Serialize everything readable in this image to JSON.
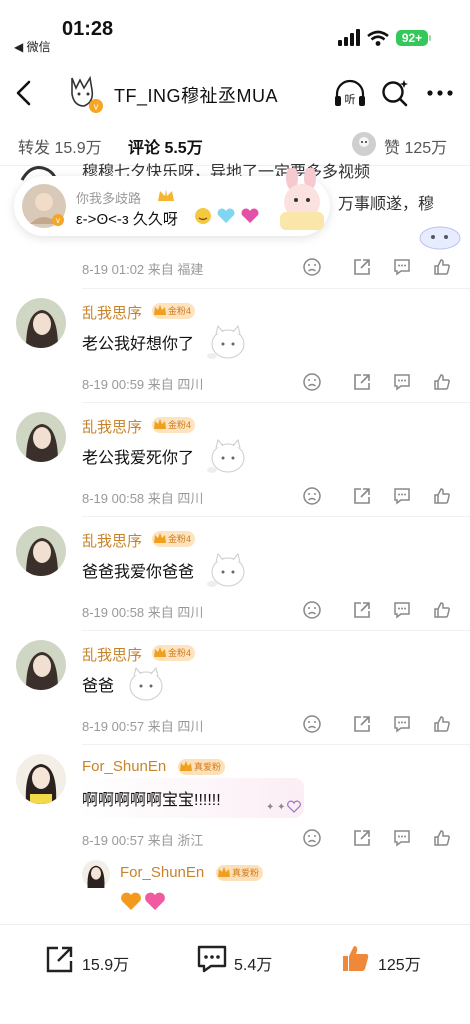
{
  "status": {
    "time": "01:28",
    "back_app": "◀ 微信",
    "battery": "92+"
  },
  "nav": {
    "title": "TF_ING穆祉丞MUA",
    "listen_label": "听"
  },
  "tabs": {
    "repost": "转发 15.9万",
    "comment": "评论 5.5万",
    "like": "赞 125万"
  },
  "popup": {
    "bg_text_1": "穆穆七夕快乐呀，异地了一定要多多视频",
    "bg_text_2": "万事顺遂，穆",
    "username": "你我多歧路",
    "text": "ε-˃ʘ˂-з 久久呀"
  },
  "comments": [
    {
      "meta": "8-19 01:02  来自 福建"
    },
    {
      "user": "乱我思序",
      "badge": "金粉4",
      "text": "老公我好想你了",
      "meta": "8-19 00:59  来自 四川"
    },
    {
      "user": "乱我思序",
      "badge": "金粉4",
      "text": "老公我爱死你了",
      "meta": "8-19 00:58  来自 四川"
    },
    {
      "user": "乱我思序",
      "badge": "金粉4",
      "text": "爸爸我爱你爸爸",
      "meta": "8-19 00:58  来自 四川"
    },
    {
      "user": "乱我思序",
      "badge": "金粉4",
      "text": "爸爸",
      "meta": "8-19 00:57  来自 四川"
    },
    {
      "user": "For_ShunEn",
      "badge": "真爱粉",
      "text": "啊啊啊啊啊宝宝!!!!!!",
      "meta": "8-19 00:57  来自 浙江"
    }
  ],
  "reply": {
    "user": "For_ShunEn",
    "badge": "真爱粉"
  },
  "bottom": {
    "repost": "15.9万",
    "comment": "5.4万",
    "like": "125万"
  },
  "colors": {
    "username": "#c8832a",
    "badge_bg": "#fde4bf",
    "like_active": "#f0883a"
  }
}
